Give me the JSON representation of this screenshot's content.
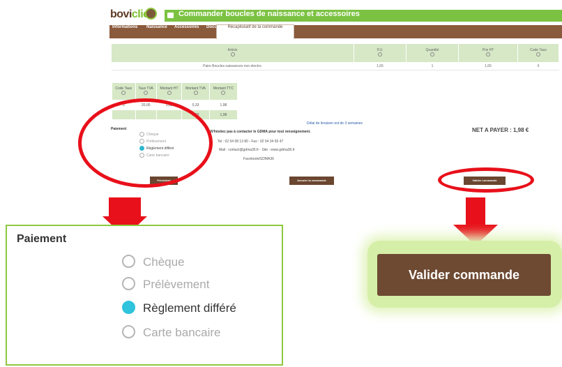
{
  "header": {
    "logo_main": "bovi",
    "logo_accent": "clic",
    "banner_title": "Commander boucles de naissance et accessoires"
  },
  "tabs": [
    "Informations",
    "Naissance",
    "Accessoires",
    "Documents",
    "Récapitulatif de la commande"
  ],
  "articles_table": {
    "headers": [
      "Article",
      "P.U.",
      "Quantité",
      "Prix HT",
      "Code Taux"
    ],
    "rows": [
      [
        "Paire Boucles naissances non electro.",
        "1,65",
        "1",
        "1,65",
        "0"
      ]
    ]
  },
  "tva_table": {
    "headers": [
      "Code Taux",
      "Taux TVA",
      "Montant HT",
      "Montant TVA",
      "Montant TTC"
    ],
    "rows": [
      [
        "0",
        "20,00",
        "1,65",
        "0,33",
        "1,98"
      ]
    ],
    "total": [
      "",
      "",
      "",
      "0,33",
      "1,98"
    ]
  },
  "delivery_note": "Délai de livraison est de 3 semaines",
  "contact": {
    "title": "N'hésitez pas à contacter le GDMA pour tout renseignement.",
    "phone": "Tel : 02 54 08 13 80 - Fax : 02 54 34 65 47",
    "mail": "Mail : contact@gdma36.fr - Site : www.gdma36.fr",
    "facebook": "Facebook/GDMA36"
  },
  "net_a_payer": "NET A PAYER : 1,98 €",
  "payment": {
    "label": "Paiement",
    "options": [
      "Chèque",
      "Prélèvement",
      "Règlement différé",
      "Carte bancaire"
    ],
    "selected_index": 2
  },
  "buttons": {
    "previous": "Précédent",
    "cancel": "Annuler la commande",
    "validate": "Valider commande"
  },
  "colors": {
    "green": "#7cc242",
    "brown": "#6b4630",
    "annotation_red": "#e8101a",
    "radio_selected": "#2fc3dc"
  }
}
